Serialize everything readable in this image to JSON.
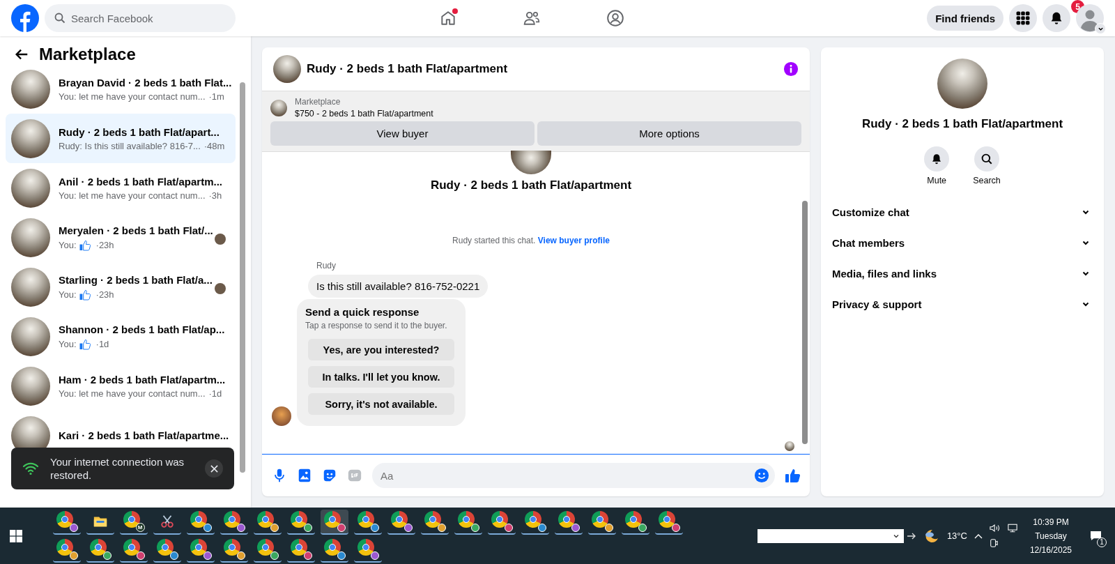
{
  "top_bar": {
    "search": {
      "placeholder": "Search Facebook"
    },
    "nav": [
      {
        "kind": "home",
        "selected": false,
        "dot": true
      },
      {
        "kind": "friends",
        "selected": false,
        "dot": false
      },
      {
        "kind": "groups",
        "selected": false,
        "dot": false
      }
    ],
    "find_friends": "Find friends",
    "notification_count": "5"
  },
  "sidebar": {
    "title": "Marketplace",
    "conversations": [
      {
        "title": "Brayan David · 2 beds 1 bath Flat...",
        "kind": "text",
        "preview": "You: let me have your contact num...",
        "time": "·1m",
        "selected": false,
        "seen": false
      },
      {
        "title": "Rudy · 2 beds 1 bath Flat/apart...",
        "kind": "text",
        "preview": "Rudy: Is this still available? 816-7...",
        "time": "·48m",
        "selected": true,
        "seen": false
      },
      {
        "title": "Anil · 2 beds 1 bath Flat/apartm...",
        "kind": "text",
        "preview": "You: let me have your contact num...",
        "time": "·3h",
        "selected": false,
        "seen": false
      },
      {
        "title": "Meryalen · 2 beds 1 bath Flat/...",
        "kind": "like",
        "preview": "You:",
        "time": "·23h",
        "selected": false,
        "seen": true
      },
      {
        "title": "Starling · 2 beds 1 bath Flat/a...",
        "kind": "like",
        "preview": "You:",
        "time": "·23h",
        "selected": false,
        "seen": true
      },
      {
        "title": "Shannon · 2 beds 1 bath Flat/ap...",
        "kind": "like",
        "preview": "You:",
        "time": "·1d",
        "selected": false,
        "seen": false
      },
      {
        "title": "Ham · 2 beds 1 bath Flat/apartm...",
        "kind": "text",
        "preview": "You: let me have your contact num...",
        "time": "·1d",
        "selected": false,
        "seen": false
      },
      {
        "title": "Kari · 2 beds 1 bath Flat/apartme...",
        "kind": "hidden",
        "selected": false,
        "seen": false
      }
    ]
  },
  "toast": {
    "text": "Your internet connection was restored."
  },
  "chat": {
    "title": "Rudy · 2 beds 1 bath Flat/apartment",
    "listing": {
      "label": "Marketplace",
      "text": "$750 - 2 beds 1 bath Flat/apartment",
      "buttons": [
        "View buyer",
        "More options"
      ]
    },
    "intro_title": "Rudy · 2 beds 1 bath Flat/apartment",
    "started": "Rudy started this chat.",
    "profile_link": "View buyer profile",
    "sender": "Rudy",
    "message": "Is this still available? 816-752-0221",
    "quick": {
      "title": "Send a quick response",
      "subtitle": "Tap a response to send it to the buyer.",
      "options": [
        "Yes, are you interested?",
        "In talks. I'll let you know.",
        "Sorry, it's not available."
      ]
    },
    "composer": {
      "placeholder": "Aa"
    }
  },
  "details": {
    "title": "Rudy · 2 beds 1 bath Flat/apartment",
    "actions": [
      {
        "kind": "mute",
        "label": "Mute"
      },
      {
        "kind": "search",
        "label": "Search"
      }
    ],
    "sections": [
      {
        "label": "Customize chat",
        "expanded": false
      },
      {
        "label": "Chat members",
        "expanded": false
      },
      {
        "label": "Media, files and links",
        "expanded": false
      },
      {
        "label": "Privacy & support",
        "expanded": false
      }
    ]
  },
  "taskbar": {
    "rows": [
      [
        {
          "kind": "browser",
          "active": false
        },
        {
          "kind": "folder",
          "active": false
        },
        {
          "kind": "browser",
          "badge": "M",
          "active": false
        },
        {
          "kind": "tool",
          "active": false
        },
        {
          "kind": "browser",
          "active": false
        },
        {
          "kind": "browser",
          "active": false
        },
        {
          "kind": "browser",
          "active": false
        },
        {
          "kind": "browser",
          "active": false
        },
        {
          "kind": "browser",
          "active": true
        },
        {
          "kind": "browser",
          "active": false
        },
        {
          "kind": "browser",
          "active": false
        },
        {
          "kind": "browser",
          "active": false
        },
        {
          "kind": "browser",
          "active": false
        },
        {
          "kind": "browser",
          "active": false
        },
        {
          "kind": "browser",
          "active": false
        },
        {
          "kind": "browser",
          "active": false
        },
        {
          "kind": "browser",
          "active": false
        },
        {
          "kind": "browser",
          "active": false
        },
        {
          "kind": "browser",
          "active": false
        }
      ],
      [
        {
          "kind": "browser",
          "active": false
        },
        {
          "kind": "browser",
          "active": false
        },
        {
          "kind": "browser",
          "active": false
        },
        {
          "kind": "browser",
          "active": false
        },
        {
          "kind": "browser",
          "active": false
        },
        {
          "kind": "browser",
          "active": false
        },
        {
          "kind": "browser",
          "active": false
        },
        {
          "kind": "browser",
          "active": false
        },
        {
          "kind": "browser",
          "active": false
        },
        {
          "kind": "browser",
          "active": false
        }
      ]
    ],
    "temperature": "13°C",
    "time": "10:39 PM",
    "day": "Tuesday",
    "date": "12/16/2025",
    "notifications": "1"
  }
}
